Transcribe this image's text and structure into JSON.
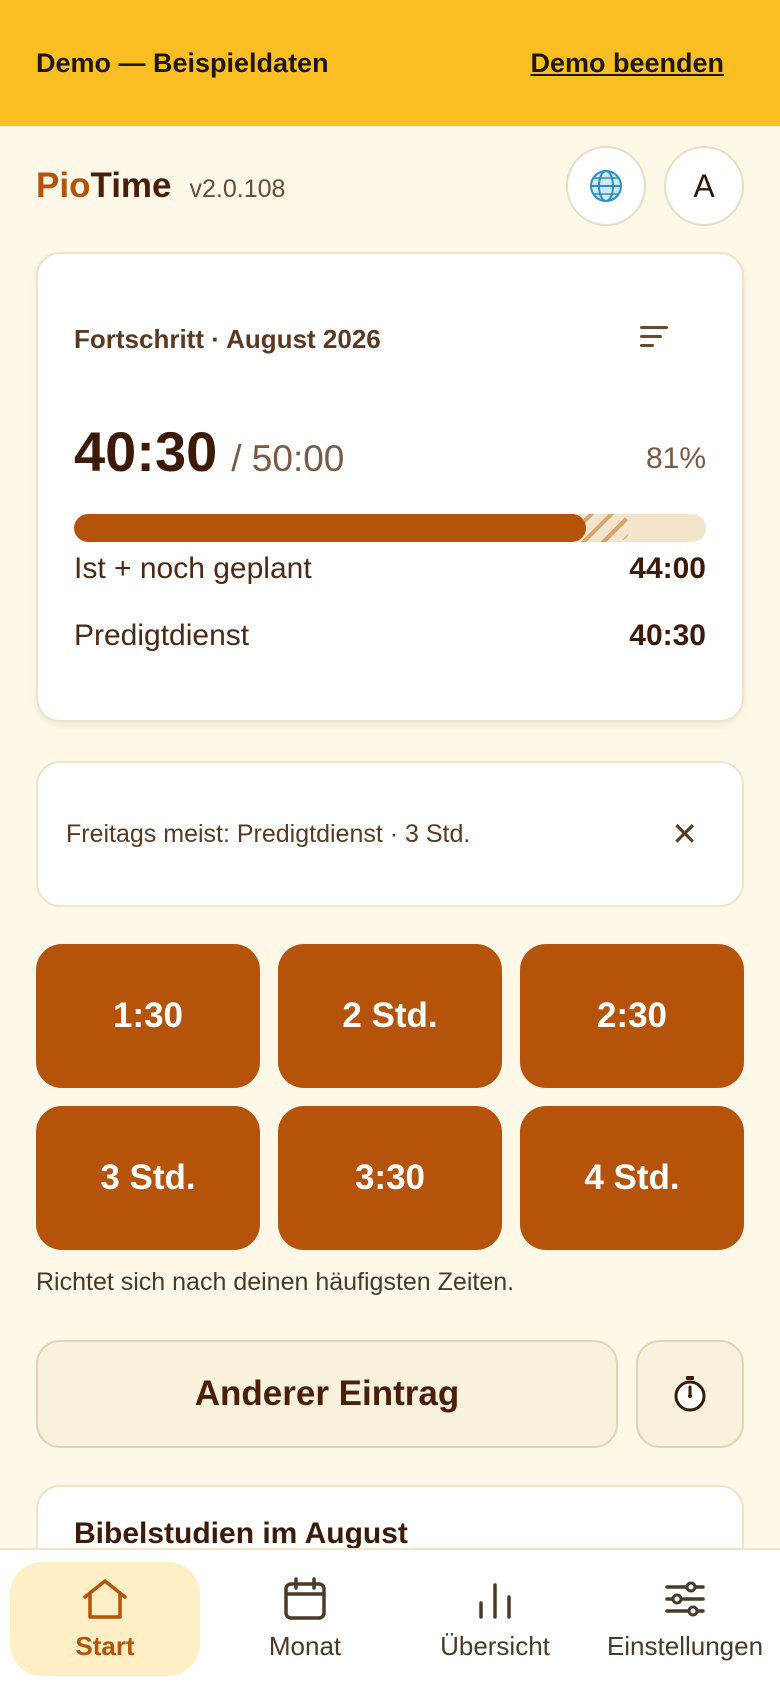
{
  "demo_banner": {
    "text": "Demo — Beispieldaten",
    "action": "Demo beenden"
  },
  "header": {
    "brand_part1": "Pio",
    "brand_part2": "Time",
    "version": "v2.0.108",
    "avatar_letter": "A",
    "language_icon": "globe-icon"
  },
  "progress": {
    "title": "Fortschritt · August 2026",
    "hours_done": "40:30",
    "hours_target": "/ 50:00",
    "percent": "81%",
    "fraction_done": 0.81,
    "fraction_planned": 0.88,
    "rows": [
      {
        "label": "Ist + noch geplant",
        "value": "44:00"
      },
      {
        "label": "Predigtdienst",
        "value": "40:30"
      }
    ]
  },
  "hint": {
    "text": "Freitags meist: Predigtdienst · 3 Std."
  },
  "quick_buttons": [
    "1:30",
    "2 Std.",
    "2:30",
    "3 Std.",
    "3:30",
    "4 Std."
  ],
  "quick_note": "Richtet sich nach deinen häufigsten Zeiten.",
  "other_entry": "Anderer Eintrag",
  "bible": {
    "title": "Bibelstudien im August"
  },
  "nav": [
    {
      "label": "Start",
      "icon": "home-icon",
      "active": true
    },
    {
      "label": "Monat",
      "icon": "calendar-icon",
      "active": false
    },
    {
      "label": "Übersicht",
      "icon": "bar-chart-icon",
      "active": false
    },
    {
      "label": "Einstellungen",
      "icon": "sliders-icon",
      "active": false
    }
  ],
  "colors": {
    "accent": "#B45309",
    "banner": "#FBBF24",
    "background": "#FEF8E8"
  }
}
